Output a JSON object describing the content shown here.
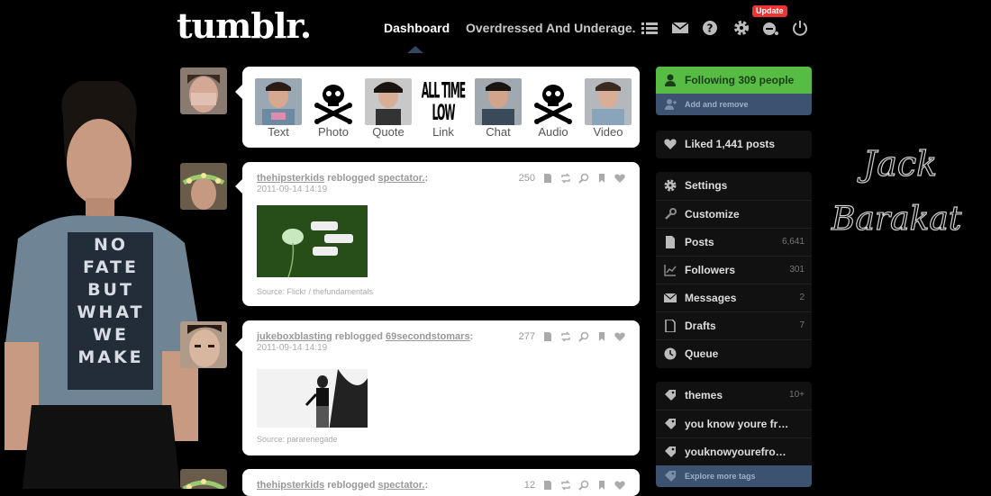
{
  "header": {
    "logo": "tumblr.",
    "nav_dashboard": "Dashboard",
    "nav_blog": "Overdressed And Underage.",
    "update_badge": "Update",
    "icons": [
      "list-icon",
      "mail-icon",
      "help-icon",
      "gear-icon",
      "edit-icon",
      "power-icon"
    ]
  },
  "background": {
    "shirt_text": "NO FATE BUT WHAT WE MAKE",
    "signature": [
      "Jack",
      "Barakat"
    ]
  },
  "post_types": [
    {
      "label": "Text",
      "icon": "photo-thumbnail"
    },
    {
      "label": "Photo",
      "icon": "skull-crossbones-icon"
    },
    {
      "label": "Quote",
      "icon": "photo-thumbnail"
    },
    {
      "label": "Link",
      "icon": "band-logo-thumbnail"
    },
    {
      "label": "Chat",
      "icon": "photo-thumbnail"
    },
    {
      "label": "Audio",
      "icon": "skull-crossbones-icon"
    },
    {
      "label": "Video",
      "icon": "photo-thumbnail"
    }
  ],
  "band_logo_text": "ALL TIME LOW",
  "posts": [
    {
      "user": "thehipsterkids",
      "action": " reblogged ",
      "source_user": "spectator.",
      "colon": ":",
      "date": "2011-09-14 14:19",
      "notes": "250",
      "source": "Source: Flickr / thefundamentals"
    },
    {
      "user": "jukeboxblasting",
      "action": " reblogged ",
      "source_user": "69secondstomars",
      "colon": ":",
      "date": "2011-09-14 14:19",
      "notes": "277",
      "source": "Source: pararenegade"
    },
    {
      "user": "thehipsterkids",
      "action": " reblogged ",
      "source_user": "spectator.",
      "colon": ":",
      "notes": "12"
    }
  ],
  "sidebar": {
    "following": "Following 309 people",
    "add_remove": "Add and remove",
    "liked": "Liked 1,441 posts",
    "menu": [
      {
        "label": "Settings",
        "count": "",
        "icon": "gear-icon"
      },
      {
        "label": "Customize",
        "count": "",
        "icon": "wrench-icon"
      },
      {
        "label": "Posts",
        "count": "6,641",
        "icon": "document-icon"
      },
      {
        "label": "Followers",
        "count": "301",
        "icon": "chart-icon"
      },
      {
        "label": "Messages",
        "count": "2",
        "icon": "mail-icon"
      },
      {
        "label": "Drafts",
        "count": "7",
        "icon": "draft-icon"
      },
      {
        "label": "Queue",
        "count": "",
        "icon": "clock-icon"
      }
    ],
    "tags": [
      {
        "label": "themes",
        "count": "10+"
      },
      {
        "label": "you know youre fr…",
        "count": ""
      },
      {
        "label": "youknowyoure​fro…",
        "count": ""
      }
    ],
    "explore_tags": "Explore more tags"
  },
  "colors": {
    "background": "#000000",
    "following_green": "#56bc44",
    "tumblr_blue": "#3c5271",
    "update_red": "#e33333"
  }
}
